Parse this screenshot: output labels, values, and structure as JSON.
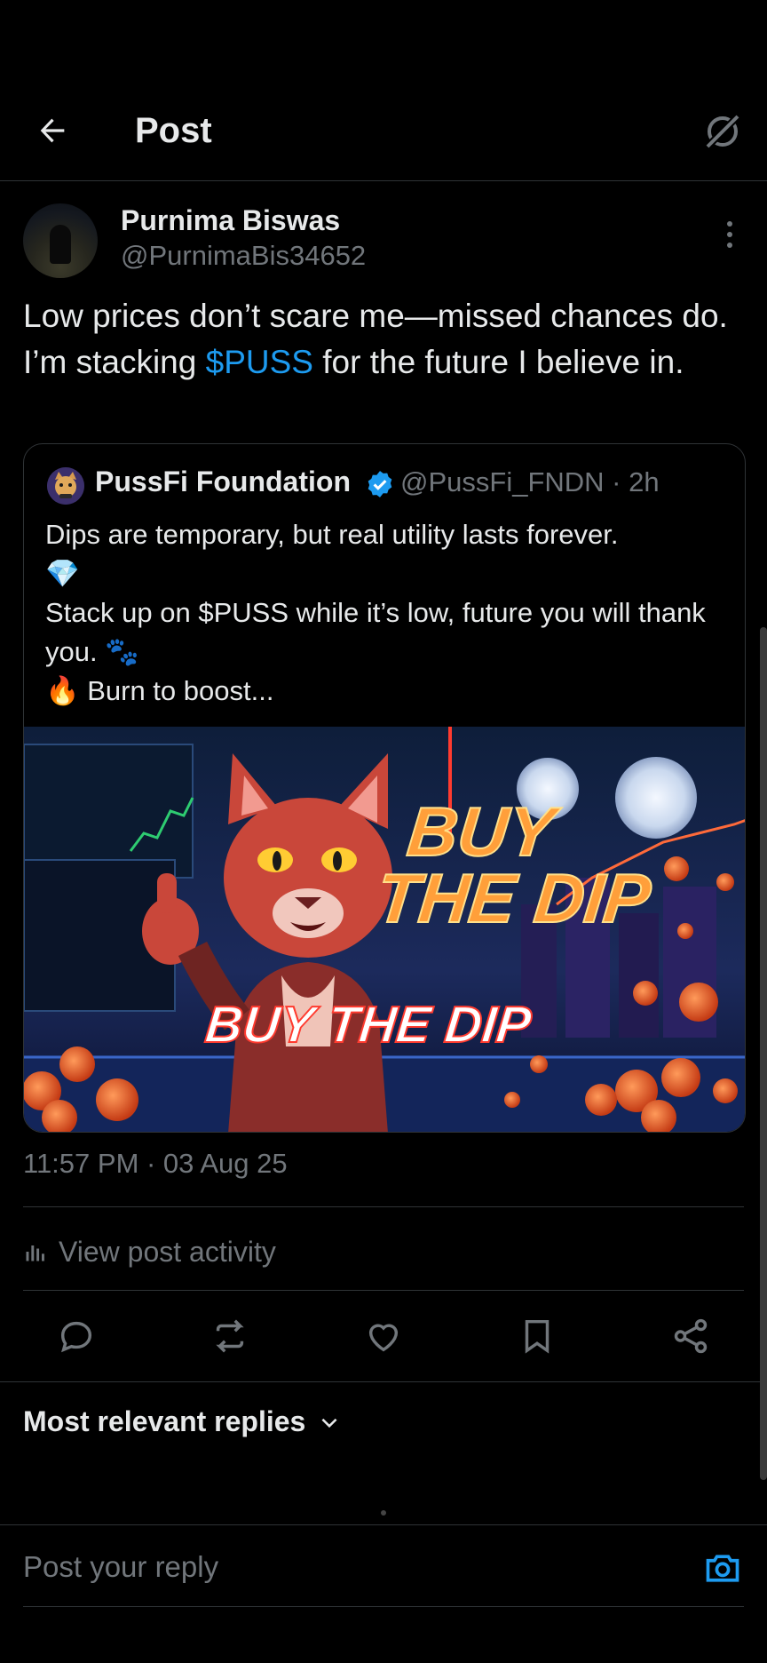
{
  "header": {
    "title": "Post",
    "back_icon": "arrow-left-icon",
    "grok_icon": "grok-icon"
  },
  "post": {
    "author_name": "Purnima Biswas",
    "author_handle": "@PurnimaBis34652",
    "text_before": "Low prices don’t scare me—missed chances do. I’m stacking ",
    "cashtag": "$PUSS",
    "text_after": " for the future I believe in.",
    "timestamp": "11:57 PM · 03 Aug 25",
    "activity_label": "View post activity"
  },
  "quote": {
    "name": "PussFi Foundation",
    "handle": "@PussFi_FNDN · 2h",
    "line1": "Dips are temporary, but real utility lasts forever.",
    "emoji_gem": "💎",
    "line2": "Stack up on $PUSS while it’s low, future you will thank you. 🐾",
    "line3": "🔥 Burn to boost...",
    "image_headline": "BUY THE DIP",
    "image_headline_small": "BUY THE DIP"
  },
  "actions": {
    "reply_icon": "reply-icon",
    "repost_icon": "repost-icon",
    "like_icon": "heart-icon",
    "bookmark_icon": "bookmark-icon",
    "share_icon": "share-icon"
  },
  "replies": {
    "sort_label": "Most relevant replies"
  },
  "reply_bar": {
    "placeholder": "Post your reply"
  },
  "colors": {
    "background": "#000000",
    "text": "#e7e9ea",
    "muted": "#71767b",
    "accent": "#1d9bf0",
    "divider": "#2f3336"
  }
}
